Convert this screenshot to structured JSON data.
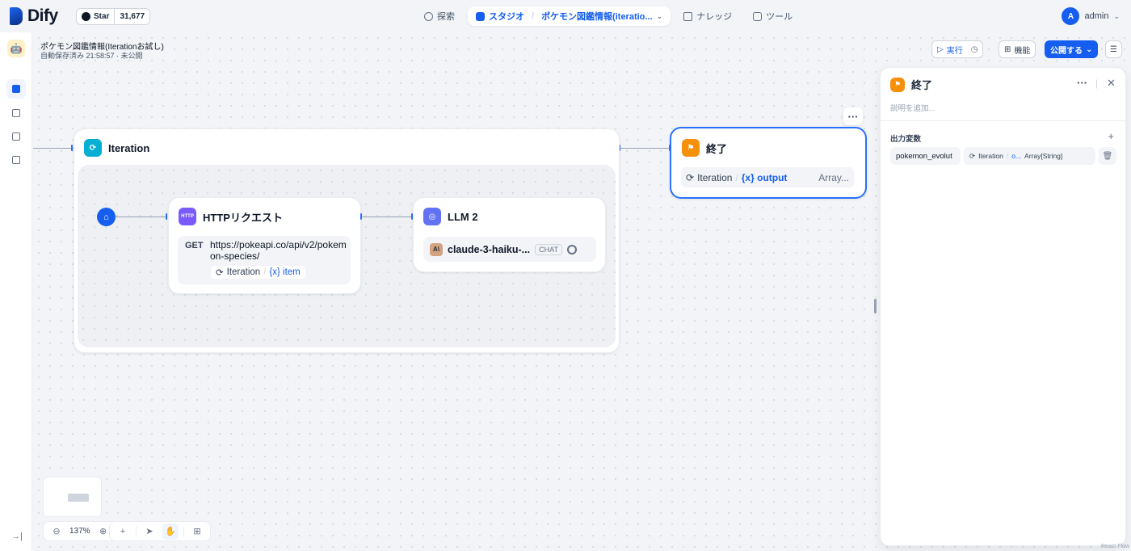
{
  "header": {
    "brand": "Dify",
    "github": {
      "label": "Star",
      "count": "31,677"
    },
    "nav": [
      {
        "label": "探索"
      },
      {
        "label": "スタジオ"
      },
      {
        "label": "ポケモン図鑑情報(iteratio..."
      },
      {
        "label": "ナレッジ"
      },
      {
        "label": "ツール"
      }
    ],
    "user": {
      "initial": "A",
      "name": "admin"
    }
  },
  "app": {
    "title": "ポケモン図鑑情報(Iterationお試し)",
    "subtitle": "自動保存済み 21:58:57 · 未公開"
  },
  "toolbar": {
    "run": "実行",
    "features": "機能",
    "publish": "公開する"
  },
  "nodes": {
    "iteration": {
      "title": "Iteration"
    },
    "http": {
      "title": "HTTPリクエスト",
      "icon_text": "HTTP",
      "method": "GET",
      "url": "https://pokeapi.co/api/v2/pokemon-species/",
      "var_node": "Iteration",
      "var_name": "{x} item"
    },
    "llm": {
      "title": "LLM 2",
      "model": "claude-3-haiku-...",
      "mode": "CHAT"
    },
    "end": {
      "title": "終了",
      "var_node": "Iteration",
      "var_name": "{x} output",
      "var_type": "Array..."
    }
  },
  "panel": {
    "title": "終了",
    "description_placeholder": "説明を追加...",
    "section": "出力変数",
    "var_name": "pokemon_evolut",
    "var_node": "Iteration",
    "var_short": "o...",
    "var_type": "Array[String]"
  },
  "zoom": "137%",
  "attribution": "React Flow",
  "colors": {
    "accent": "#155eef",
    "end": "#f79009",
    "iteration": "#06aed4",
    "http": "#7a5af8",
    "llm": "#6172f3"
  }
}
